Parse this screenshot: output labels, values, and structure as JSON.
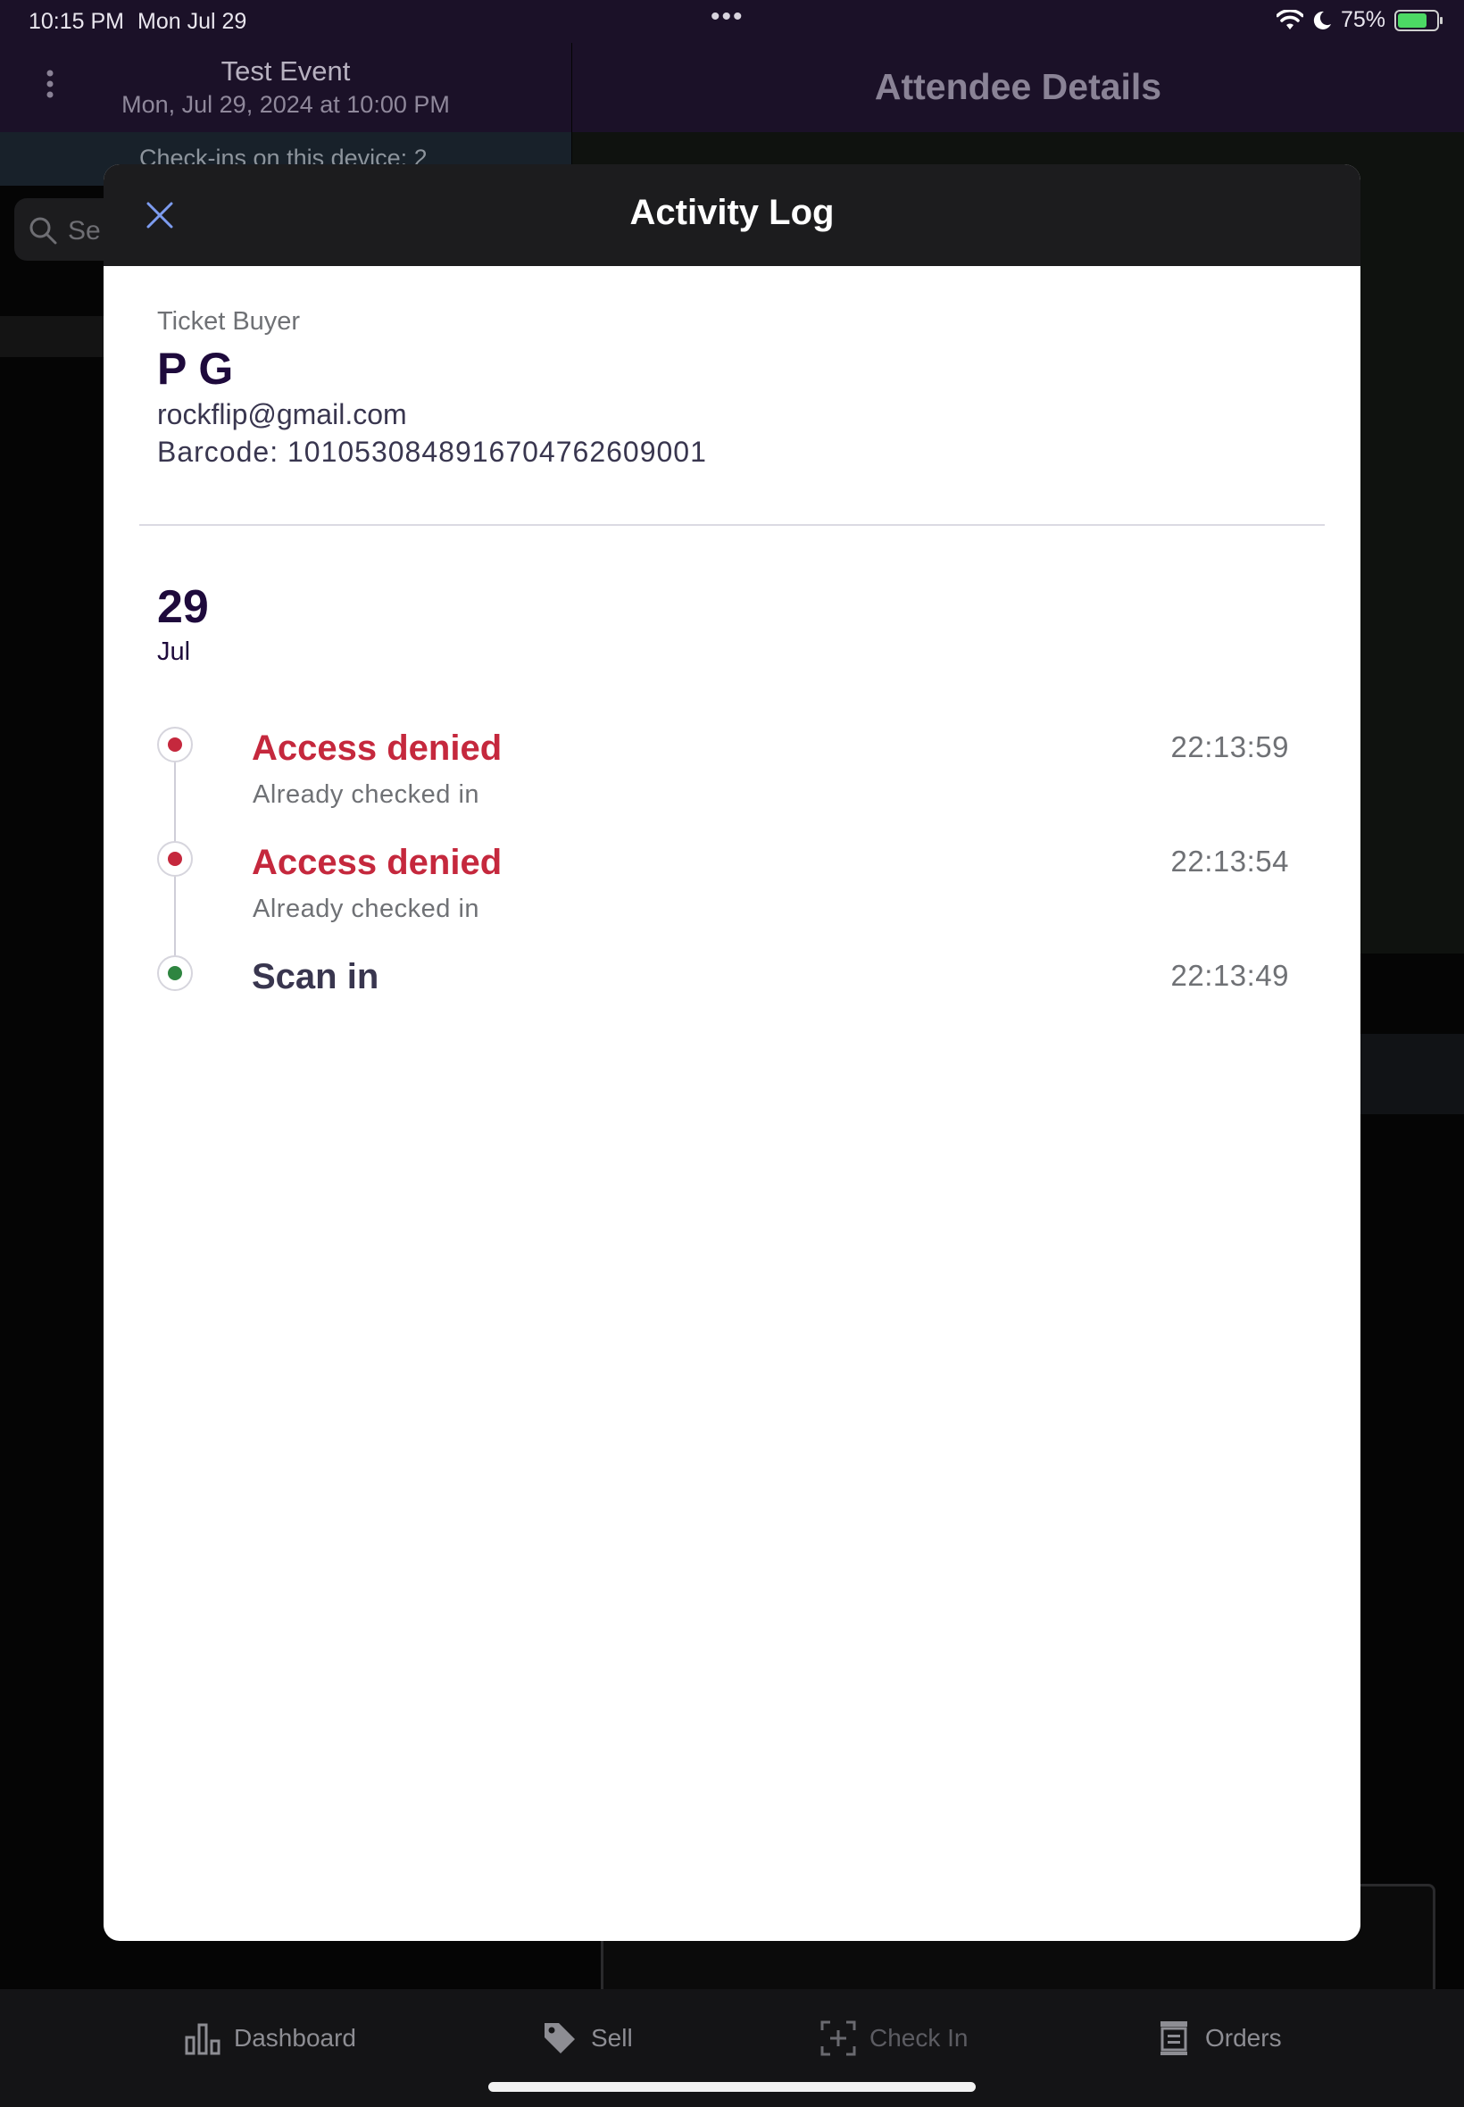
{
  "status_bar": {
    "time": "10:15 PM",
    "date": "Mon Jul 29",
    "multitask_dots": "•••",
    "battery_percent": "75%",
    "battery_level": 0.75,
    "battery_color": "#4cd964"
  },
  "left_pane": {
    "event_title": "Test Event",
    "event_date": "Mon, Jul 29, 2024 at 10:00 PM",
    "checkins_text": "Check-ins on this device: 2",
    "search_placeholder": "Se"
  },
  "right_pane": {
    "title": "Attendee Details"
  },
  "tab_bar": {
    "tabs": [
      {
        "label": "Dashboard",
        "icon": "bar-chart-icon"
      },
      {
        "label": "Sell",
        "icon": "tag-icon"
      },
      {
        "label": "Check In",
        "icon": "scan-plus-icon"
      },
      {
        "label": "Orders",
        "icon": "orders-icon"
      }
    ]
  },
  "modal": {
    "title": "Activity Log",
    "close_icon": "close-icon",
    "buyer": {
      "label": "Ticket Buyer",
      "name": "P G",
      "email": "rockflip@gmail.com",
      "barcode": "Barcode: 10105308489167047626O9001"
    },
    "date": {
      "day": "29",
      "month": "Jul"
    },
    "entries": [
      {
        "title": "Access denied",
        "subtitle": "Already checked in",
        "time": "22:13:59",
        "status": "denied",
        "color": "#c5283d"
      },
      {
        "title": "Access denied",
        "subtitle": "Already checked in",
        "time": "22:13:54",
        "status": "denied",
        "color": "#c5283d"
      },
      {
        "title": "Scan in",
        "subtitle": "",
        "time": "22:13:49",
        "status": "success",
        "color": "#2e8540"
      }
    ]
  },
  "colors": {
    "header_purple": "#1b1128",
    "denied_red": "#c5283d",
    "success_green": "#2e8540",
    "name_navy": "#1e0a3c"
  }
}
